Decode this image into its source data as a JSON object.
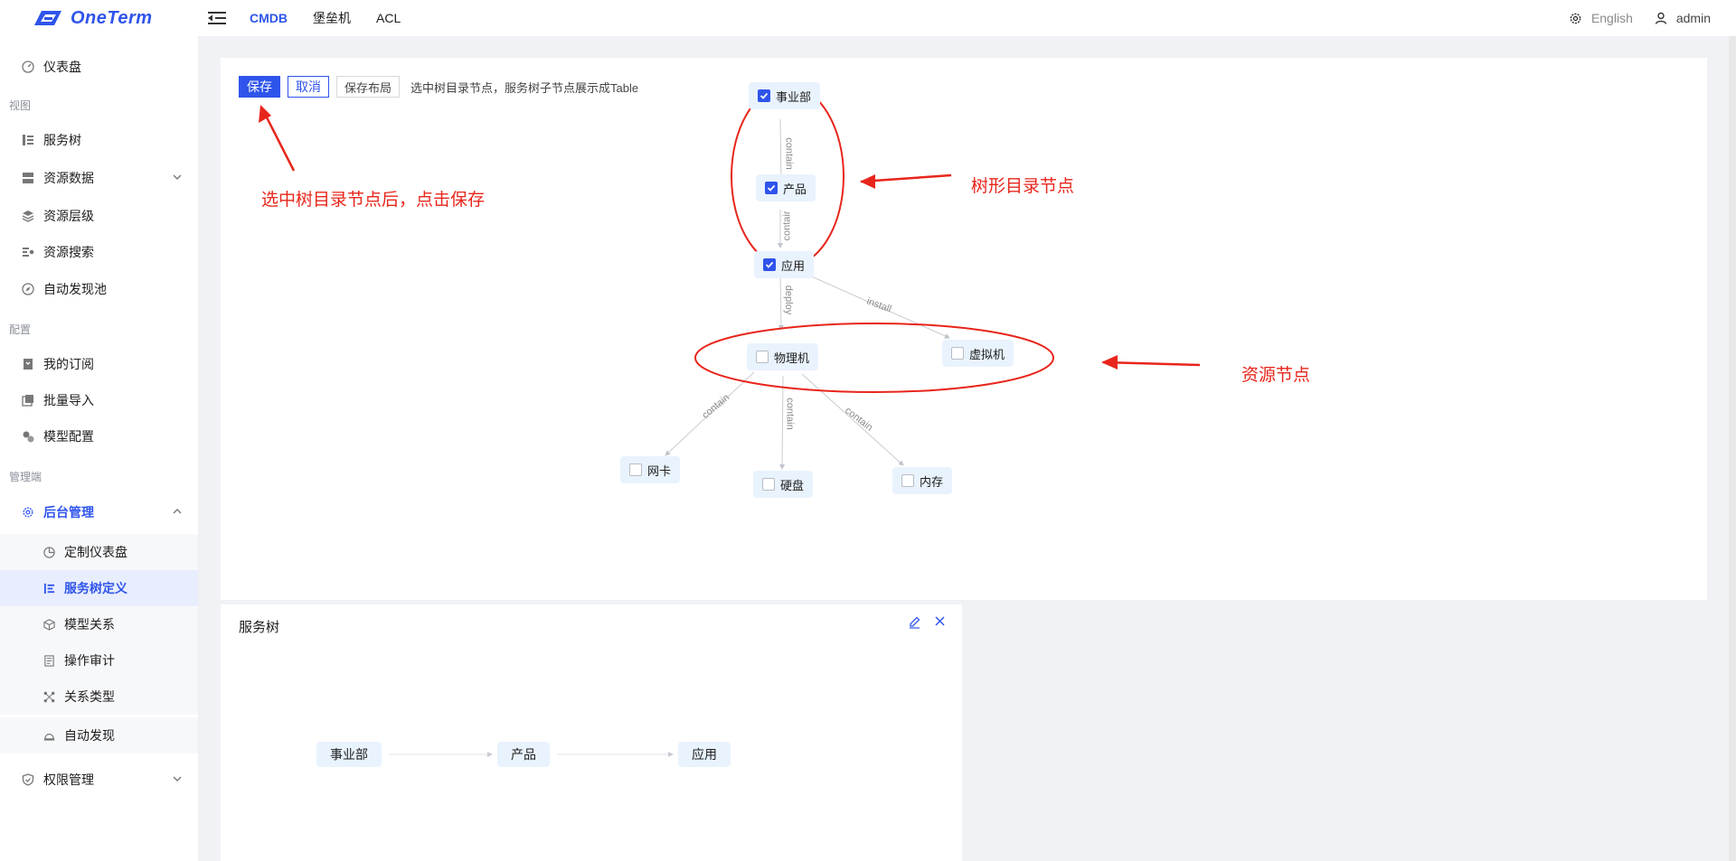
{
  "app": {
    "name": "OneTerm"
  },
  "topnav": {
    "items": [
      "CMDB",
      "堡垒机",
      "ACL"
    ],
    "active": "CMDB"
  },
  "header_right": {
    "language": "English",
    "user": "admin"
  },
  "sidebar": {
    "dashboard": "仪表盘",
    "group_view": "视图",
    "service_tree": "服务树",
    "resource_data": "资源数据",
    "resource_level": "资源层级",
    "resource_search": "资源搜索",
    "auto_discovery_pool": "自动发现池",
    "group_config": "配置",
    "my_subscription": "我的订阅",
    "batch_import": "批量导入",
    "model_config": "模型配置",
    "group_admin": "管理端",
    "backend_admin": "后台管理",
    "sub_items": [
      "定制仪表盘",
      "服务树定义",
      "模型关系",
      "操作审计",
      "关系类型",
      "自动发现"
    ],
    "sub_selected": "服务树定义",
    "permission": "权限管理"
  },
  "toolbar": {
    "save": "保存",
    "cancel": "取消",
    "save_layout": "保存布局",
    "hint": "选中树目录节点，服务树子节点展示成Table"
  },
  "graph": {
    "nodes": [
      {
        "label": "事业部",
        "checked": true
      },
      {
        "label": "产品",
        "checked": true
      },
      {
        "label": "应用",
        "checked": true
      },
      {
        "label": "物理机",
        "checked": false
      },
      {
        "label": "虚拟机",
        "checked": false
      },
      {
        "label": "网卡",
        "checked": false
      },
      {
        "label": "硬盘",
        "checked": false
      },
      {
        "label": "内存",
        "checked": false
      }
    ],
    "edges": [
      "contain",
      "contair",
      "deploy",
      "install",
      "contain",
      "contain",
      "contain"
    ]
  },
  "annotations": {
    "save_hint": "选中树目录节点后，点击保存",
    "tree_nodes": "树形目录节点",
    "resource_nodes": "资源节点"
  },
  "service_tree_panel": {
    "title": "服务树",
    "nodes": [
      "事业部",
      "产品",
      "应用"
    ]
  },
  "colors": {
    "accent": "#2f54eb",
    "annotation": "#e8251b",
    "node_bg": "#e9f3fd"
  }
}
